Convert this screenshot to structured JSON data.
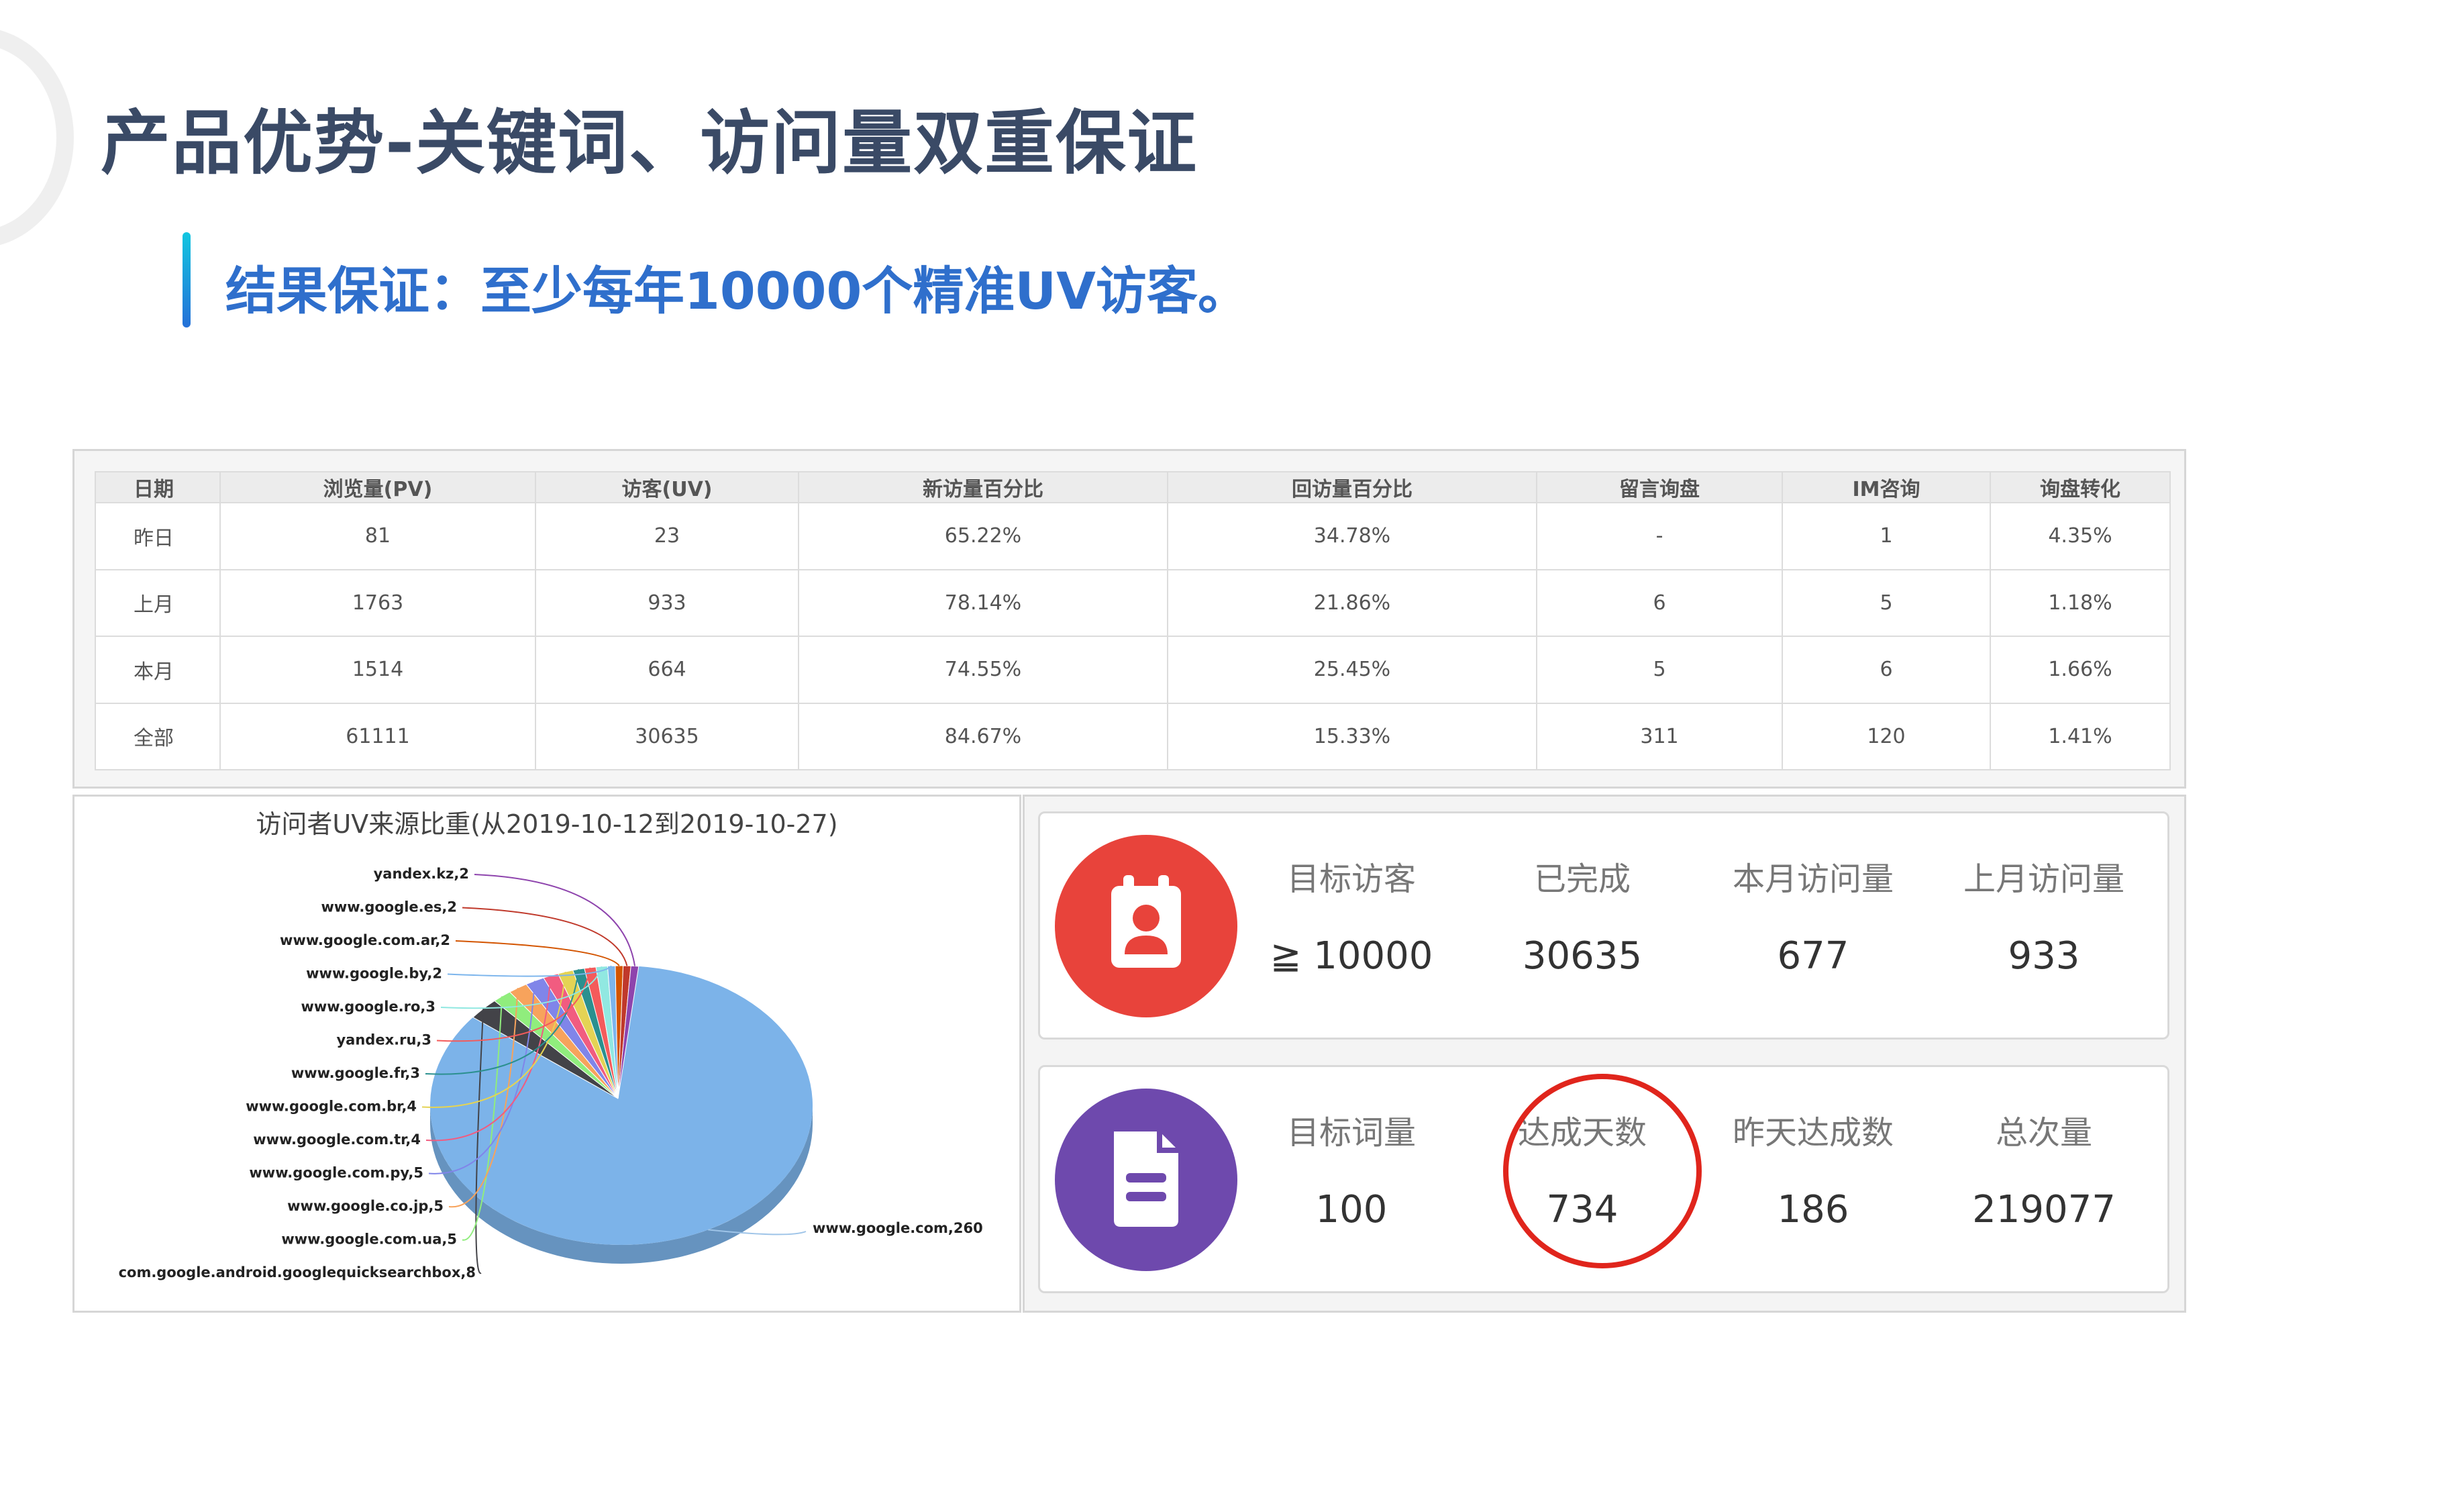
{
  "slide": {
    "title": "产品优势-关键词、访问量双重保证",
    "subtitle": "结果保证：至少每年10000个精准UV访客。"
  },
  "stats_table": {
    "headers": [
      "日期",
      "浏览量(PV)",
      "访客(UV)",
      "新访量百分比",
      "回访量百分比",
      "留言询盘",
      "IM咨询",
      "询盘转化"
    ],
    "rows": [
      [
        "昨日",
        "81",
        "23",
        "65.22%",
        "34.78%",
        "-",
        "1",
        "4.35%"
      ],
      [
        "上月",
        "1763",
        "933",
        "78.14%",
        "21.86%",
        "6",
        "5",
        "1.18%"
      ],
      [
        "本月",
        "1514",
        "664",
        "74.55%",
        "25.45%",
        "5",
        "6",
        "1.66%"
      ],
      [
        "全部",
        "61111",
        "30635",
        "84.67%",
        "15.33%",
        "311",
        "120",
        "1.41%"
      ]
    ]
  },
  "chart_data": {
    "type": "pie",
    "title": "访问者UV来源比重(从2019-10-12到2019-10-27)",
    "slices": [
      {
        "label": "www.google.com,260",
        "name": "www.google.com",
        "value": 260,
        "color": "#7cb3e9"
      },
      {
        "label": "com.google.android.googlequicksearchbox,8",
        "name": "com.google.android.googlequicksearchbox",
        "value": 8,
        "color": "#434348"
      },
      {
        "label": "www.google.com.ua,5",
        "name": "www.google.com.ua",
        "value": 5,
        "color": "#90ed7d"
      },
      {
        "label": "www.google.co.jp,5",
        "name": "www.google.co.jp",
        "value": 5,
        "color": "#f7a35c"
      },
      {
        "label": "www.google.com.py,5",
        "name": "www.google.com.py",
        "value": 5,
        "color": "#8085e9"
      },
      {
        "label": "www.google.com.tr,4",
        "name": "www.google.com.tr",
        "value": 4,
        "color": "#f15c80"
      },
      {
        "label": "www.google.com.br,4",
        "name": "www.google.com.br",
        "value": 4,
        "color": "#e4d354"
      },
      {
        "label": "www.google.fr,3",
        "name": "www.google.fr",
        "value": 3,
        "color": "#2b908f"
      },
      {
        "label": "yandex.ru,3",
        "name": "yandex.ru",
        "value": 3,
        "color": "#f45b5b"
      },
      {
        "label": "www.google.ro,3",
        "name": "www.google.ro",
        "value": 3,
        "color": "#91e8e1"
      },
      {
        "label": "www.google.by,2",
        "name": "www.google.by",
        "value": 2,
        "color": "#7cb5ec"
      },
      {
        "label": "www.google.com.ar,2",
        "name": "www.google.com.ar",
        "value": 2,
        "color": "#d35400"
      },
      {
        "label": "www.google.es,2",
        "name": "www.google.es",
        "value": 2,
        "color": "#c0392b"
      },
      {
        "label": "yandex.kz,2",
        "name": "yandex.kz",
        "value": 2,
        "color": "#8e44ad"
      }
    ]
  },
  "kpi": {
    "row1": [
      {
        "label": "目标访客",
        "value": "≧ 10000"
      },
      {
        "label": "已完成",
        "value": "30635"
      },
      {
        "label": "本月访问量",
        "value": "677"
      },
      {
        "label": "上月访问量",
        "value": "933"
      }
    ],
    "row2": [
      {
        "label": "目标词量",
        "value": "100"
      },
      {
        "label": "达成天数",
        "value": "734"
      },
      {
        "label": "昨天达成数",
        "value": "186"
      },
      {
        "label": "总次量",
        "value": "219077"
      }
    ],
    "icons": [
      {
        "name": "contact-card-icon",
        "color": "#e8433b"
      },
      {
        "name": "document-icon",
        "color": "#6e49ad"
      }
    ],
    "highlight_color": "#e0251c"
  }
}
